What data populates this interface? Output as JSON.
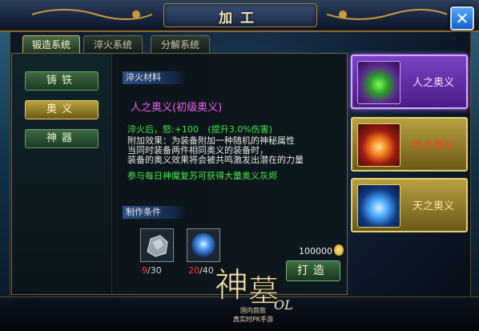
{
  "window": {
    "title": "加工",
    "close_glyph": "✕"
  },
  "tabs": [
    {
      "label": "锻造系统",
      "active": true
    },
    {
      "label": "淬火系统",
      "active": false
    },
    {
      "label": "分解系统",
      "active": false
    }
  ],
  "left_menu": [
    {
      "label": "铸铁",
      "active": false
    },
    {
      "label": "奥义",
      "active": true
    },
    {
      "label": "神器",
      "active": false
    }
  ],
  "content": {
    "section_material": "淬火材料",
    "item_name": "人之奥义(初级奥义)",
    "stat_line": "淬火后，怒:+100",
    "stat_bonus": "(提升3.0%伤害)",
    "effect_lines": [
      "附加效果：为装备附加一种随机的神秘属性",
      "当同时装备两件相同奥义的装备时，",
      "装备的奥义效果将会被共鸣激发出潜在的力量"
    ],
    "tip": "参与每日神魔复苏可获得大量奥义灰烬",
    "section_conditions": "制作条件",
    "materials": [
      {
        "icon": "ore-icon",
        "have": "9",
        "need": "/30"
      },
      {
        "icon": "orb-icon",
        "have": "20",
        "need": "/40"
      }
    ],
    "price": "100000",
    "forge_label": "打造"
  },
  "right_list": [
    {
      "label": "人之奥义",
      "selected": true
    },
    {
      "label": "地之奥义",
      "selected": false
    },
    {
      "label": "天之奥义",
      "selected": false
    }
  ],
  "branding": {
    "logo_text": "神墓OL",
    "sub_line_1": "国内首款",
    "sub_line_2": "真实时PK手游"
  },
  "colors": {
    "accent_gold": "#cdb45a",
    "selected_purple": "#7b43c4",
    "green_text": "#48e848",
    "red_text": "#ff3c2c"
  }
}
